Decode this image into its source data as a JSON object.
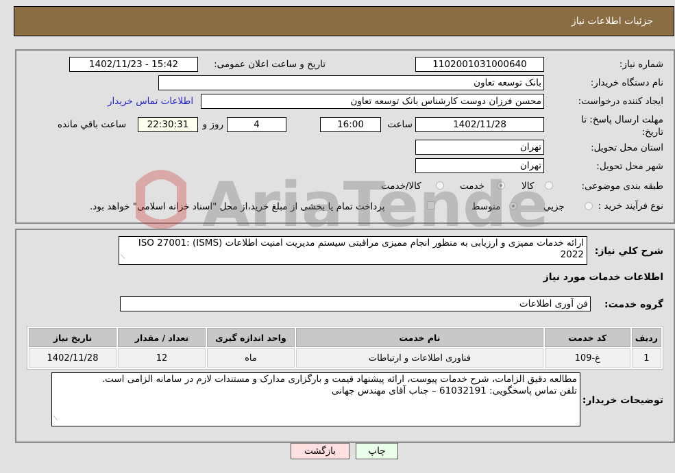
{
  "header": {
    "title": "جزئیات اطلاعات نیاز"
  },
  "fields": {
    "need_number_label": "شماره نیاز:",
    "need_number": "1102001031000640",
    "announce_label": "تاریخ و ساعت اعلان عمومی:",
    "announce_value": "1402/11/23 - 15:42",
    "buyer_org_label": "نام دستگاه خریدار:",
    "buyer_org": "بانک توسعه تعاون",
    "creator_label": "ایجاد کننده درخواست:",
    "creator": "محسن فرزان دوست کارشناس بانک توسعه تعاون",
    "buyer_contact_link": "اطلاعات تماس خریدار",
    "deadline_label": "مهلت ارسال پاسخ: تا تاریخ:",
    "deadline_date": "1402/11/28",
    "time_label": "ساعت",
    "deadline_time": "16:00",
    "days_value": "4",
    "days_label": "روز و",
    "remaining_time": "22:30:31",
    "remaining_label": "ساعت باقي مانده",
    "province_label": "استان محل تحویل:",
    "province": "تهران",
    "city_label": "شهر محل تحویل:",
    "city": "تهران",
    "category_label": "طبقه بندی موضوعی:",
    "category_options": [
      {
        "label": "کالا",
        "selected": false
      },
      {
        "label": "خدمت",
        "selected": true
      },
      {
        "label": "کالا/خدمت",
        "selected": false
      }
    ],
    "process_label": "نوع فرآیند خرید :",
    "process_options": [
      {
        "label": "جزيي",
        "selected": false
      },
      {
        "label": "متوسط",
        "selected": true
      }
    ],
    "treasury_note": "پرداخت تمام یا بخشی از مبلغ خرید،از محل \"اسناد خزانه اسلامی\" خواهد بود.",
    "treasury_checked": false
  },
  "summary": {
    "label": "شرح کلي نياز:",
    "text": "ارائه خدمات ممیزی و ارزیابی به منظور انجام ممیزی مراقبتی سیستم مدیریت امنیت اطلاعات (ISMS) ISO 27001: 2022"
  },
  "services": {
    "section_title": "اطلاعات خدمات مورد نیاز",
    "group_label": "گروه خدمت:",
    "group_value": "فن آوری اطلاعات",
    "table": {
      "columns": [
        "ردیف",
        "کد خدمت",
        "نام خدمت",
        "واحد اندازه گیری",
        "تعداد / مقدار",
        "تاریخ نیاز"
      ],
      "rows": [
        [
          "1",
          "غ-109",
          "فناوری اطلاعات و ارتباطات",
          "ماه",
          "12",
          "1402/11/28"
        ]
      ]
    }
  },
  "buyer_notes": {
    "label": "توضیحات خریدار:",
    "line1": "مطالعه دقیق الزامات، شرح خدمات پیوست، ارائه پیشنهاد قیمت و بارگزاری مدارک و مستندات لازم در سامانه الزامی است.",
    "line2": "تلفن تماس پاسخگویی: 61032191 – جناب آقای مهندس جهانی"
  },
  "buttons": {
    "print": "چاپ",
    "back": "بازگشت"
  },
  "watermark": "AriaTender.neT",
  "colors": {
    "header_bg": "#8b6d43",
    "print_bg": "#eaffea",
    "back_bg": "#ffe0e0",
    "link": "#2222cc"
  }
}
